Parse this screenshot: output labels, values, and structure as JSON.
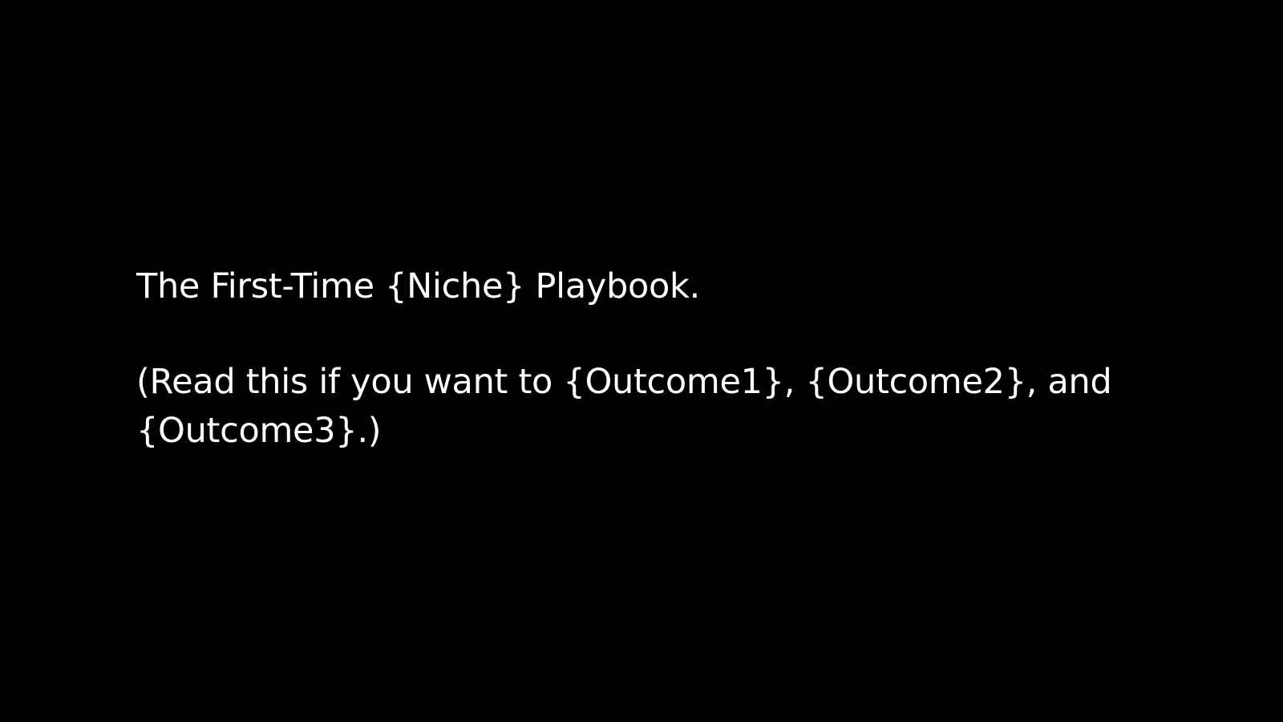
{
  "slide": {
    "title": "The First-Time {Niche} Playbook.",
    "subtitle": "(Read this if you want to {Outcome1}, {Outcome2}, and {Outcome3}.)"
  },
  "colors": {
    "background": "#000000",
    "text": "#ffffff"
  }
}
